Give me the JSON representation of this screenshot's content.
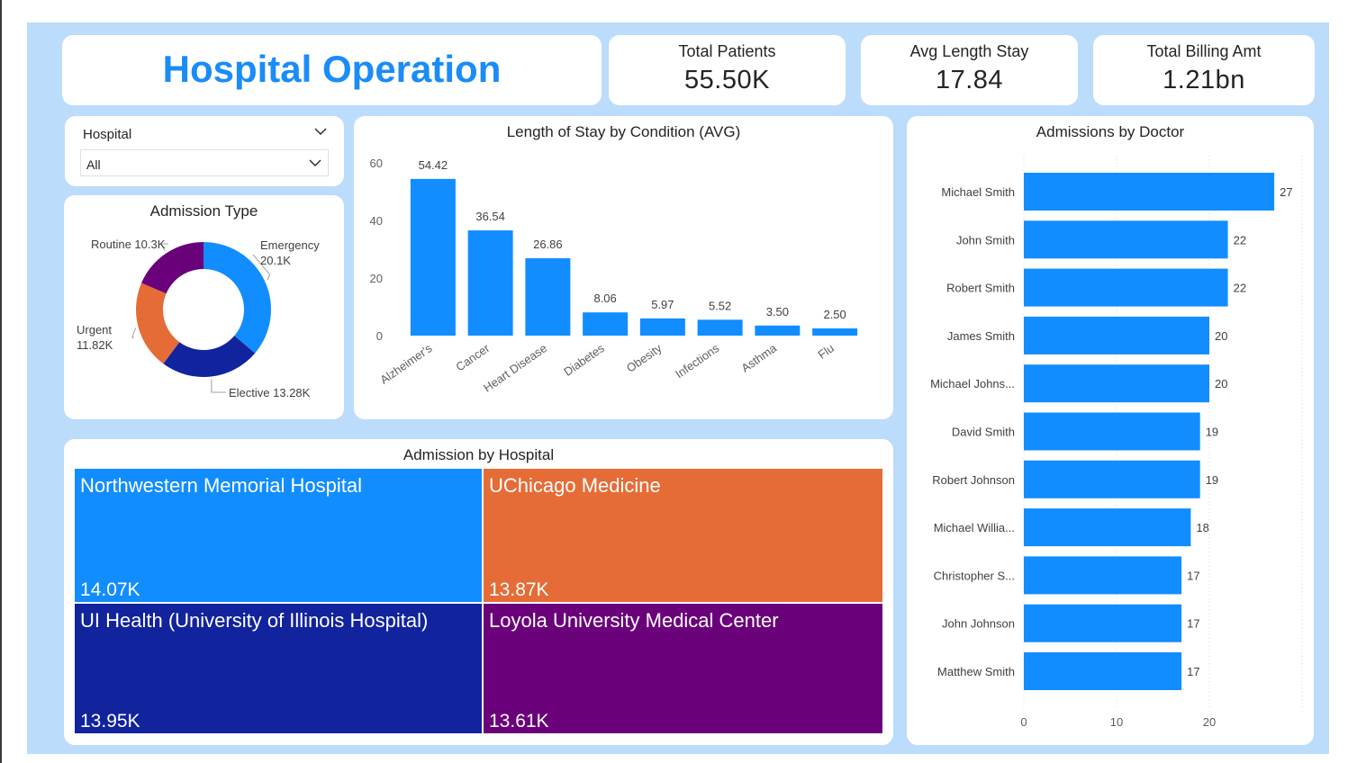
{
  "header": {
    "title": "Hospital Operation"
  },
  "kpis": [
    {
      "label": "Total Patients",
      "value": "55.50K"
    },
    {
      "label": "Avg Length Stay",
      "value": "17.84"
    },
    {
      "label": "Total Billing Amt",
      "value": "1.21bn"
    }
  ],
  "slicer": {
    "label": "Hospital",
    "selected": "All"
  },
  "colors": {
    "accent": "#1a8cf7",
    "background": "#bcdcfb",
    "blue": "#118dff",
    "navy": "#12239e",
    "orange": "#e66c37",
    "purple": "#6b007b"
  },
  "chart_data": [
    {
      "type": "pie",
      "title": "Admission Type",
      "variant": "donut",
      "categories": [
        "Emergency",
        "Elective",
        "Urgent",
        "Routine"
      ],
      "values": [
        20.1,
        13.28,
        11.82,
        10.3
      ],
      "labels": [
        "Emergency 20.1K",
        "Elective 13.28K",
        "Urgent 11.82K",
        "Routine 10.3K"
      ],
      "colors": [
        "#118dff",
        "#12239e",
        "#e66c37",
        "#6b007b"
      ]
    },
    {
      "type": "bar",
      "title": "Length of Stay by Condition (AVG)",
      "categories": [
        "Alzheimer's",
        "Cancer",
        "Heart Disease",
        "Diabetes",
        "Obesity",
        "Infections",
        "Asthma",
        "Flu"
      ],
      "values": [
        54.42,
        36.54,
        26.86,
        8.06,
        5.97,
        5.52,
        3.5,
        2.5
      ],
      "data_labels": [
        "54.42",
        "36.54",
        "26.86",
        "8.06",
        "5.97",
        "5.52",
        "3.50",
        "2.50"
      ],
      "ylim": [
        0,
        60
      ],
      "yticks": [
        "0",
        "20",
        "40",
        "60"
      ],
      "grid": false,
      "color": "#118dff"
    },
    {
      "type": "bar",
      "orientation": "horizontal",
      "title": "Admissions by Doctor",
      "categories": [
        "Michael Smith",
        "John Smith",
        "Robert Smith",
        "James Smith",
        "Michael Johns...",
        "David Smith",
        "Robert Johnson",
        "Michael Willia...",
        "Christopher S...",
        "John Johnson",
        "Matthew Smith"
      ],
      "values": [
        27,
        22,
        22,
        20,
        20,
        19,
        19,
        18,
        17,
        17,
        17
      ],
      "xlim": [
        0,
        30
      ],
      "xticks": [
        "0",
        "10",
        "20"
      ],
      "grid": true,
      "color": "#118dff"
    },
    {
      "type": "treemap",
      "title": "Admission by Hospital",
      "categories": [
        "Northwestern Memorial Hospital",
        "UChicago Medicine",
        "UI Health (University of Illinois Hospital)",
        "Loyola University Medical Center"
      ],
      "values": [
        14.07,
        13.87,
        13.95,
        13.61
      ],
      "value_labels": [
        "14.07K",
        "13.87K",
        "13.95K",
        "13.61K"
      ],
      "colors": [
        "#118dff",
        "#e66c37",
        "#12239e",
        "#6b007b"
      ]
    }
  ]
}
